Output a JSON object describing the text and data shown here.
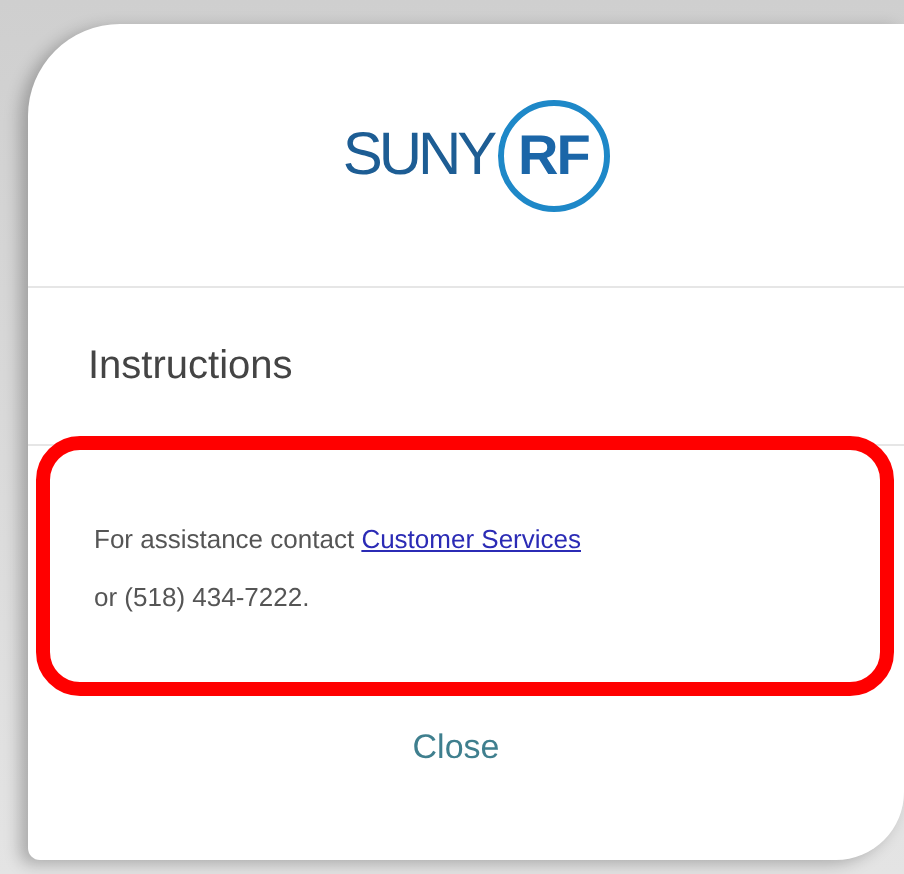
{
  "logo": {
    "word": "SUNY",
    "badge": "RF"
  },
  "heading": "Instructions",
  "message": {
    "before": "For assistance contact",
    "link": "Customer Services",
    "after": "or (518) 434-7222.",
    "highlighted": true
  },
  "buttons": [
    "Close"
  ]
}
